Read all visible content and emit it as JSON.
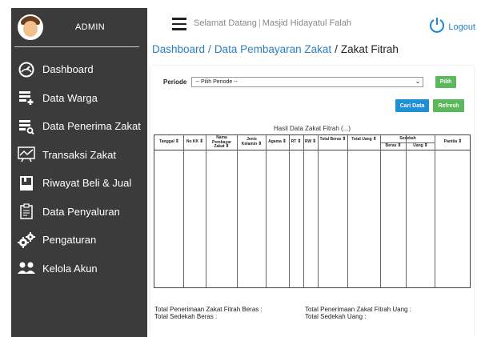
{
  "sidebar": {
    "user_label": "ADMIN",
    "items": [
      {
        "label": "Dashboard",
        "icon": "speedometer-icon"
      },
      {
        "label": "Data Warga",
        "icon": "user-list-add-icon"
      },
      {
        "label": "Data Penerima Zakat",
        "icon": "user-list-search-icon"
      },
      {
        "label": "Transaksi Zakat",
        "icon": "chart-board-icon"
      },
      {
        "label": "Riwayat Beli & Jual",
        "icon": "book-icon"
      },
      {
        "label": "Data Penyaluran",
        "icon": "clipboard-icon"
      },
      {
        "label": "Pengaturan",
        "icon": "gears-icon"
      },
      {
        "label": "Kelola Akun",
        "icon": "users-icon"
      }
    ]
  },
  "topbar": {
    "welcome": "Selamat Datang",
    "org": "Masjid Hidayatul Falah",
    "logout_label": "Logout"
  },
  "breadcrumb": {
    "root": "Dashboard",
    "section": "Data Pembayaran Zakat",
    "current": "Zakat Fitrah"
  },
  "filter": {
    "label": "Periode",
    "selected": "-- Pilih Periode --",
    "pilih_label": "Pilih"
  },
  "actions": {
    "cari_label": "Cari Data",
    "refresh_label": "Refresh"
  },
  "table": {
    "title": "Hasil Data Zakat Fitrah (...)",
    "columns": [
      "Tanggal",
      "No KK",
      "Nama Pembayar Zakat",
      "Jenis Kelamin",
      "Agama",
      "RT",
      "RW",
      "Total Beras",
      "Total Uang",
      "Sedekah",
      "Panitia"
    ],
    "sedekah_sub": [
      "Beras",
      "Uang"
    ]
  },
  "totals": {
    "beras": "Total Penerimaan Zakat Fitrah Beras :",
    "sedekah_beras": "Total Sedekah Beras :",
    "uang": "Total Penerimaan Zakat Fitrah Uang :",
    "sedekah_uang": "Total Sedekah Uang :"
  },
  "colors": {
    "sidebar_bg": "#3b3b3b",
    "link": "#2a7fbf",
    "btn_green": "#5cb85c",
    "btn_blue": "#1f8fd6"
  }
}
